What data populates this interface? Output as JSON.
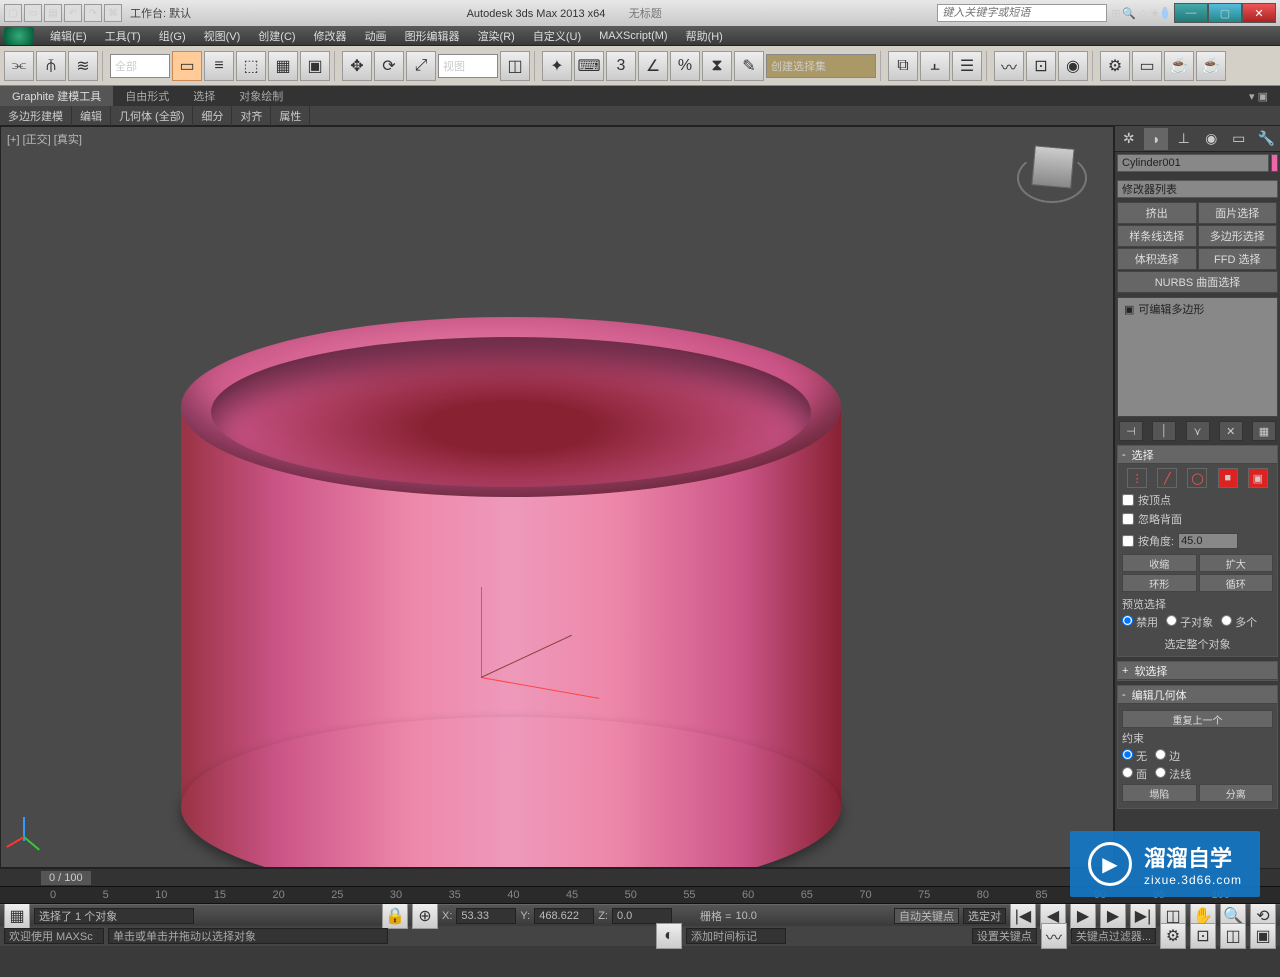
{
  "titlebar": {
    "workspace_label": "工作台: 默认",
    "app_title": "Autodesk 3ds Max  2013 x64",
    "doc_title": "无标题",
    "search_placeholder": "键入关键字或短语"
  },
  "menu": {
    "edit": "编辑(E)",
    "tools": "工具(T)",
    "group": "组(G)",
    "views": "视图(V)",
    "create": "创建(C)",
    "modifiers": "修改器",
    "animation": "动画",
    "graph": "图形编辑器",
    "rendering": "渲染(R)",
    "customize": "自定义(U)",
    "maxscript": "MAXScript(M)",
    "help": "帮助(H)"
  },
  "toolbar": {
    "filter": "全部",
    "refcoord": "视图",
    "named_sel": "创建选择集"
  },
  "ribbon": {
    "tabs": {
      "graphite": "Graphite 建模工具",
      "freeform": "自由形式",
      "selection": "选择",
      "paint": "对象绘制"
    },
    "sub": {
      "poly": "多边形建模",
      "edit": "编辑",
      "geom": "几何体 (全部)",
      "subd": "细分",
      "align": "对齐",
      "props": "属性"
    }
  },
  "viewport": {
    "label": "[+] [正交] [真实]"
  },
  "cmd": {
    "object_name": "Cylinder001",
    "modlist_placeholder": "修改器列表",
    "stack_item": "可编辑多边形",
    "buttons": {
      "extrude": "挤出",
      "face_sel": "面片选择",
      "spline_sel": "样条线选择",
      "poly_sel": "多边形选择",
      "vol_sel": "体积选择",
      "ffd_sel": "FFD 选择",
      "nurbs": "NURBS 曲面选择"
    },
    "sel_rollout": "选择",
    "by_vertex": "按顶点",
    "ignore_backfacing": "忽略背面",
    "by_angle": "按角度:",
    "angle_val": "45.0",
    "shrink": "收缩",
    "grow": "扩大",
    "ring": "环形",
    "loop": "循环",
    "preview_sel": "预览选择",
    "off": "禁用",
    "subobj_r": "子对象",
    "multi": "多个",
    "sel_whole": "选定整个对象",
    "soft_rollout": "软选择",
    "editgeom_rollout": "编辑几何体",
    "repeat": "重复上一个",
    "constraints": "约束",
    "none": "无",
    "edge": "边",
    "face": "面",
    "normal": "法线",
    "collapse": "塌陷",
    "detach": "分离"
  },
  "time": {
    "slider": "0 / 100",
    "ticks": [
      "0",
      "5",
      "10",
      "15",
      "20",
      "25",
      "30",
      "35",
      "40",
      "45",
      "50",
      "55",
      "60",
      "65",
      "70",
      "75",
      "80",
      "85",
      "90",
      "95",
      "100"
    ]
  },
  "status": {
    "selected": "选择了 1 个对象",
    "x_lbl": "X:",
    "x": "53.33",
    "y_lbl": "Y:",
    "y": "468.622",
    "z_lbl": "Z:",
    "z": "0.0",
    "grid_lbl": "栅格 =",
    "grid": "10.0",
    "autokey": "自动关键点",
    "selset_lbl": "选定对"
  },
  "prompt": {
    "welcome": "欢迎使用 MAXSc",
    "hint": "单击或单击并拖动以选择对象",
    "addtime": "添加时间标记",
    "setkey": "设置关键点",
    "keyfilter": "关键点过滤器..."
  },
  "watermark": {
    "big": "溜溜自学",
    "small": "zixue.3d66.com"
  }
}
